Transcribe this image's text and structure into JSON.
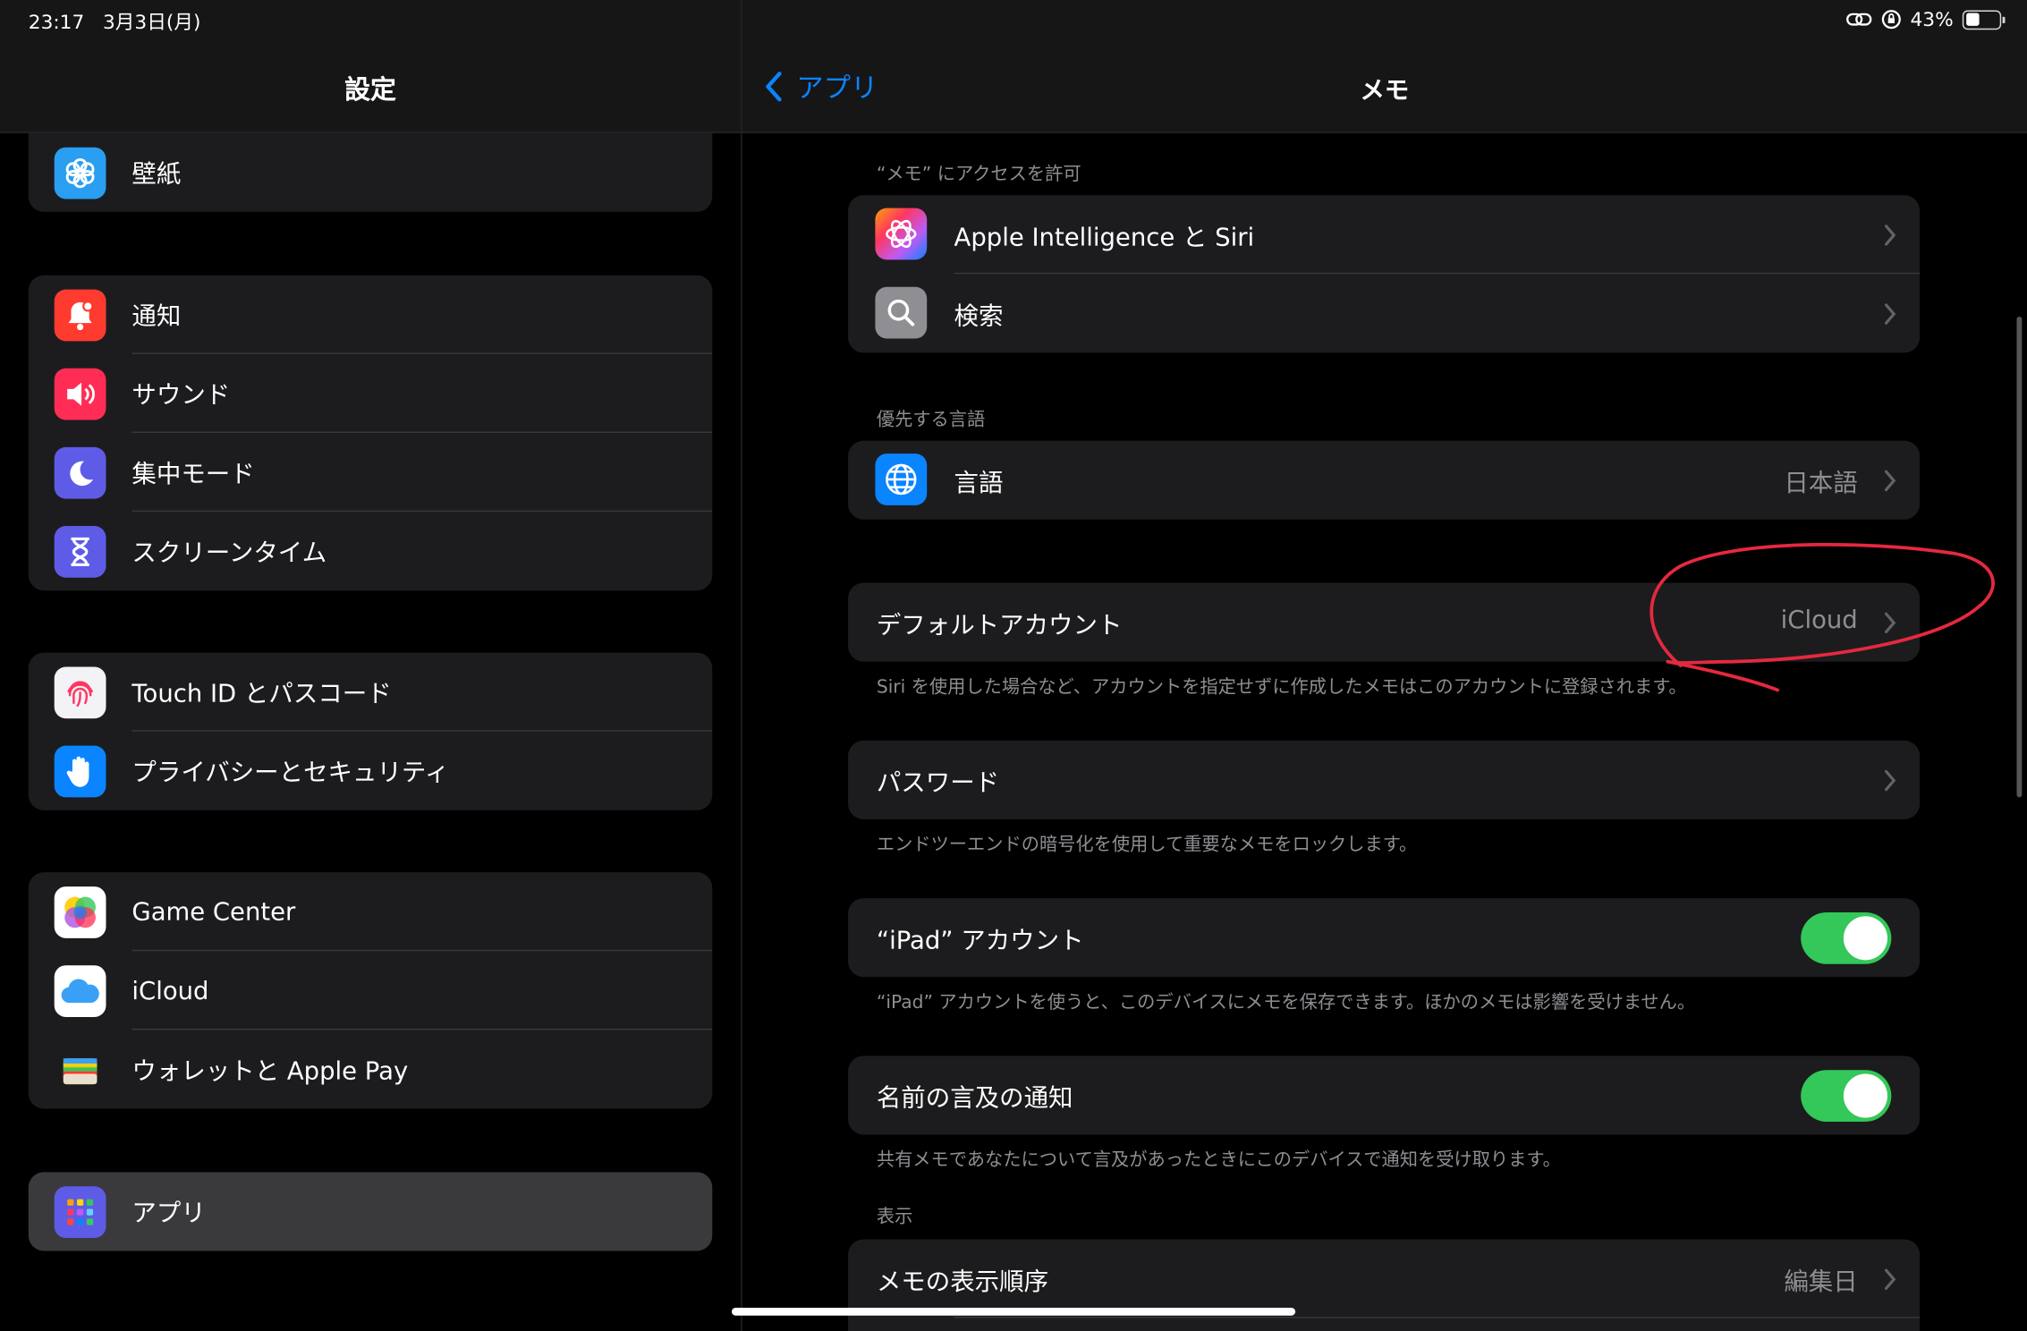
{
  "status": {
    "time": "23:17",
    "date": "3月3日(月)",
    "battery": "43%",
    "battery_level": 0.43
  },
  "sidebar": {
    "title": "設定",
    "groups": [
      [
        {
          "label": "壁紙",
          "icon": "wallpaper-icon"
        }
      ],
      [
        {
          "label": "通知",
          "icon": "bell-icon"
        },
        {
          "label": "サウンド",
          "icon": "speaker-icon"
        },
        {
          "label": "集中モード",
          "icon": "moon-icon"
        },
        {
          "label": "スクリーンタイム",
          "icon": "hourglass-icon"
        }
      ],
      [
        {
          "label": "Touch ID とパスコード",
          "icon": "fingerprint-icon"
        },
        {
          "label": "プライバシーとセキュリティ",
          "icon": "hand-icon"
        }
      ],
      [
        {
          "label": "Game Center",
          "icon": "game-center-icon"
        },
        {
          "label": "iCloud",
          "icon": "icloud-icon"
        },
        {
          "label": "ウォレットと Apple Pay",
          "icon": "wallet-icon"
        }
      ],
      [
        {
          "label": "アプリ",
          "icon": "apps-grid-icon",
          "selected": true
        }
      ]
    ]
  },
  "detail": {
    "back_label": "アプリ",
    "title": "メモ",
    "access_header": "“メモ” にアクセスを許可",
    "access_rows": [
      {
        "label": "Apple Intelligence と Siri",
        "icon": "siri-icon"
      },
      {
        "label": "検索",
        "icon": "search-icon"
      }
    ],
    "language_header": "優先する言語",
    "language_row": {
      "label": "言語",
      "value": "日本語",
      "icon": "globe-icon"
    },
    "default_account": {
      "label": "デフォルトアカウント",
      "value": "iCloud"
    },
    "default_account_note": "Siri を使用した場合など、アカウントを指定せずに作成したメモはこのアカウントに登録されます。",
    "password": {
      "label": "パスワード"
    },
    "password_note": "エンドツーエンドの暗号化を使用して重要なメモをロックします。",
    "ipad_account": {
      "label": "“iPad” アカウント",
      "on": true
    },
    "ipad_account_note": "“iPad” アカウントを使うと、このデバイスにメモを保存できます。ほかのメモは影響を受けません。",
    "mention_notify": {
      "label": "名前の言及の通知",
      "on": true
    },
    "mention_note": "共有メモであなたについて言及があったときにこのデバイスで通知を受け取ります。",
    "display_header": "表示",
    "sort_row": {
      "label": "メモの表示順序",
      "value": "編集日"
    }
  },
  "colors": {
    "accent": "#0a84ff",
    "toggle_on": "#34c759",
    "annotation": "#e5293f"
  }
}
